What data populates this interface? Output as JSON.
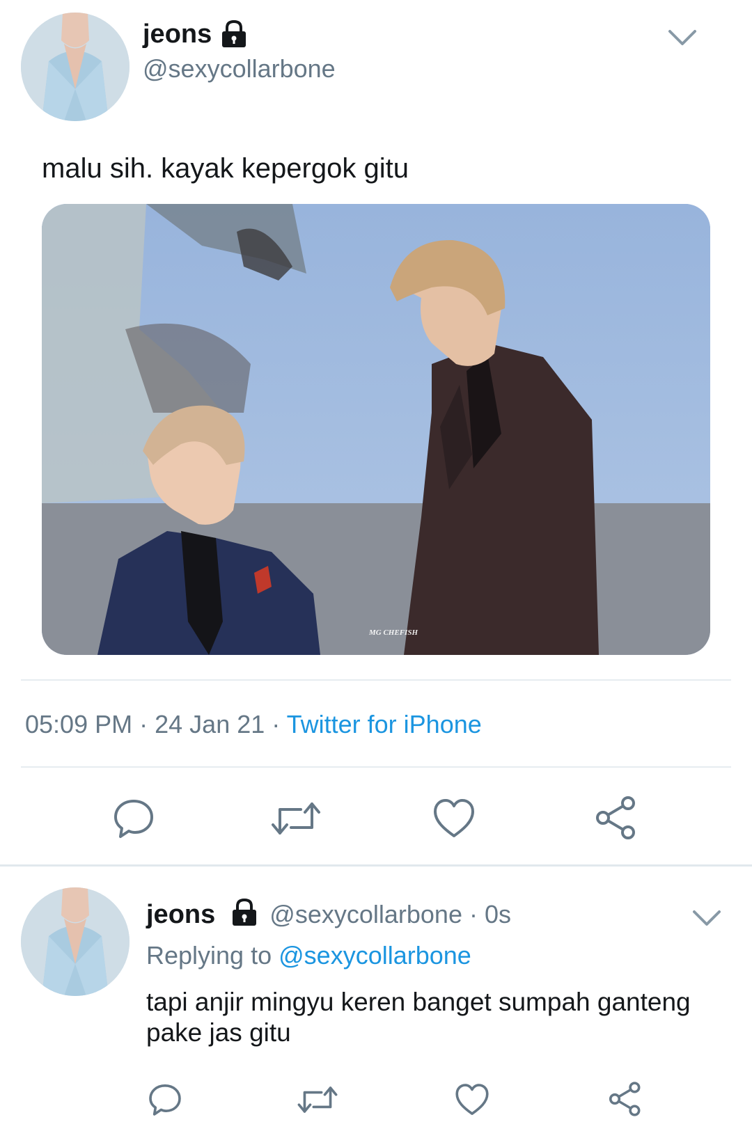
{
  "main_tweet": {
    "display_name": "jeons",
    "handle": "@sexycollarbone",
    "text": "malu sih. kayak kepergok gitu",
    "image_watermark": "MG CHEFISH",
    "time": "05:09 PM",
    "date": "24 Jan 21",
    "source": "Twitter for iPhone",
    "separator": "·",
    "actions": [
      "reply-icon",
      "retweet-icon",
      "like-icon",
      "share-icon"
    ]
  },
  "reply_tweet": {
    "display_name": "jeons",
    "handle": "@sexycollarbone",
    "time_ago": "0s",
    "separator": "·",
    "replying_prefix": "Replying to",
    "replying_to": "@sexycollarbone",
    "text": "tapi anjir mingyu keren banget sumpah ganteng pake jas gitu",
    "actions": [
      "reply-icon",
      "retweet-icon",
      "like-icon",
      "share-icon"
    ]
  },
  "colors": {
    "text": "#14171a",
    "secondary": "#657786",
    "link": "#1b95e0",
    "divider": "#e6ecf0"
  }
}
